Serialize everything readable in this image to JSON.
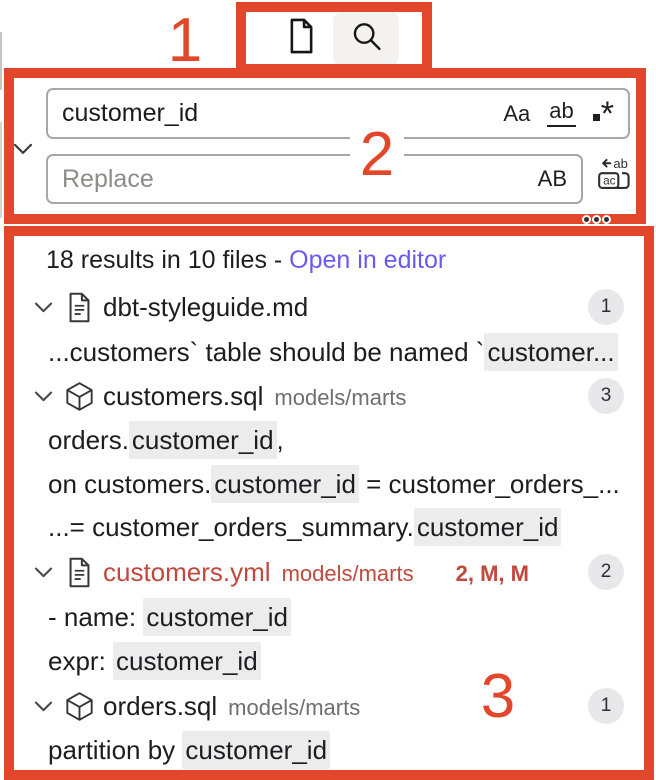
{
  "colors": {
    "annotation_red": "#e2472b",
    "link_purple": "#6a5af0",
    "file_error_red": "#c0483c",
    "match_highlight": "#ececec",
    "badge_bg": "#e8e8ea"
  },
  "icons": {
    "toolbar": [
      "file-icon",
      "search-icon"
    ],
    "search_panel": [
      "chevron-down-icon",
      "replace-all-icon",
      "more-actions-icon"
    ],
    "result_tree": [
      "chevron-down-icon",
      "document-icon",
      "model-cube-icon"
    ]
  },
  "annotations": {
    "box1": "1",
    "box2": "2",
    "box3": "3"
  },
  "search": {
    "query": "customer_id",
    "replace_placeholder": "Replace",
    "options": {
      "match_case": "Aa",
      "whole_word": "ab",
      "regex_star": "*",
      "preserve_case": "AB"
    }
  },
  "results": {
    "summary": "18 results in 10 files",
    "separator": " - ",
    "open_in_editor": "Open in editor",
    "rows": [
      {
        "type": "file",
        "icon": "document",
        "name": "dbt-styleguide.md",
        "path": "",
        "git": "",
        "badge": "1"
      },
      {
        "type": "match",
        "segments": [
          {
            "text": "...customers` table should be named `",
            "hl": false
          },
          {
            "text": "customer...",
            "hl": true
          }
        ]
      },
      {
        "type": "file",
        "icon": "model-cube",
        "name": "customers.sql",
        "path": "models/marts",
        "git": "",
        "badge": "3"
      },
      {
        "type": "match",
        "segments": [
          {
            "text": "orders.",
            "hl": false
          },
          {
            "text": "customer_id",
            "hl": true
          },
          {
            "text": ",",
            "hl": false
          }
        ]
      },
      {
        "type": "match",
        "segments": [
          {
            "text": "on customers.",
            "hl": false
          },
          {
            "text": "customer_id",
            "hl": true
          },
          {
            "text": " = customer_orders_...",
            "hl": false
          }
        ]
      },
      {
        "type": "match",
        "segments": [
          {
            "text": "...= customer_orders_summary.",
            "hl": false
          },
          {
            "text": "customer_id",
            "hl": true
          }
        ]
      },
      {
        "type": "file",
        "icon": "document",
        "name": "customers.yml",
        "path": "models/marts",
        "git": "2, M, M",
        "badge": "2",
        "error": true
      },
      {
        "type": "match",
        "segments": [
          {
            "text": "- name: ",
            "hl": false
          },
          {
            "text": "customer_id",
            "hl": true
          }
        ]
      },
      {
        "type": "match",
        "segments": [
          {
            "text": "expr: ",
            "hl": false
          },
          {
            "text": "customer_id",
            "hl": true
          }
        ]
      },
      {
        "type": "file",
        "icon": "model-cube",
        "name": "orders.sql",
        "path": "models/marts",
        "git": "",
        "badge": "1"
      },
      {
        "type": "match",
        "segments": [
          {
            "text": "partition by ",
            "hl": false
          },
          {
            "text": "customer_id",
            "hl": true
          }
        ]
      }
    ]
  }
}
